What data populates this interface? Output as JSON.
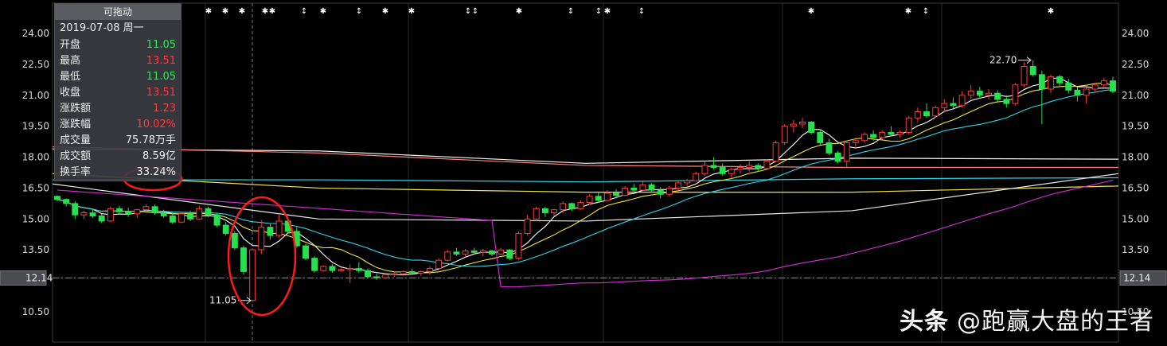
{
  "panel": {
    "title": "可拖动",
    "date": "2019-07-08 周一",
    "rows": [
      {
        "label": "开盘",
        "value": "11.05",
        "color": "green"
      },
      {
        "label": "最高",
        "value": "13.51",
        "color": "red"
      },
      {
        "label": "最低",
        "value": "11.05",
        "color": "green"
      },
      {
        "label": "收盘",
        "value": "13.51",
        "color": "red"
      },
      {
        "label": "涨跌额",
        "value": "1.23",
        "color": "red"
      },
      {
        "label": "涨跌幅",
        "value": "10.02%",
        "color": "red"
      },
      {
        "label": "成交量",
        "value": "75.78万手",
        "color": "white"
      },
      {
        "label": "成交额",
        "value": "8.59亿",
        "color": "white"
      },
      {
        "label": "换手率",
        "value": "33.24%",
        "color": "white"
      }
    ]
  },
  "watermark": {
    "brand": "头条",
    "handle": "@跑赢大盘的王者"
  },
  "chart_data": {
    "type": "candlestick",
    "y_ticks": [
      "24.00",
      "22.50",
      "21.00",
      "19.50",
      "18.00",
      "16.50",
      "15.00",
      "13.50",
      "10.50"
    ],
    "ylim": [
      9.8,
      24.8
    ],
    "crosshair_price": "12.14",
    "annotations": [
      {
        "text": "11.05",
        "value": 11.05
      },
      {
        "text": "22.70",
        "value": 22.7
      }
    ],
    "up_color": "#ff3b3b",
    "down_color": "#27e04d",
    "candles": [
      [
        16.1,
        16.15,
        15.85,
        15.95
      ],
      [
        15.95,
        16.0,
        15.6,
        15.75
      ],
      [
        15.75,
        15.85,
        15.0,
        15.2
      ],
      [
        15.2,
        15.4,
        15.0,
        15.3
      ],
      [
        15.3,
        15.45,
        15.05,
        15.15
      ],
      [
        15.15,
        15.25,
        14.8,
        14.9
      ],
      [
        14.9,
        15.6,
        14.85,
        15.5
      ],
      [
        15.5,
        15.65,
        15.2,
        15.35
      ],
      [
        15.35,
        15.55,
        15.1,
        15.25
      ],
      [
        15.25,
        15.5,
        15.05,
        15.45
      ],
      [
        15.45,
        15.7,
        15.3,
        15.6
      ],
      [
        15.6,
        15.7,
        15.2,
        15.3
      ],
      [
        15.3,
        15.45,
        15.05,
        15.15
      ],
      [
        15.15,
        15.3,
        14.75,
        14.85
      ],
      [
        14.85,
        15.35,
        14.8,
        15.25
      ],
      [
        15.25,
        15.4,
        14.9,
        15.0
      ],
      [
        15.0,
        15.65,
        14.95,
        15.5
      ],
      [
        15.5,
        15.6,
        15.1,
        15.2
      ],
      [
        15.2,
        15.3,
        14.6,
        14.7
      ],
      [
        14.7,
        14.85,
        14.2,
        14.3
      ],
      [
        14.3,
        14.4,
        13.5,
        13.6
      ],
      [
        13.6,
        13.7,
        12.3,
        12.45
      ],
      [
        11.05,
        13.51,
        11.05,
        13.51
      ],
      [
        13.51,
        14.95,
        13.3,
        14.6
      ],
      [
        14.6,
        14.8,
        14.0,
        14.2
      ],
      [
        14.2,
        15.2,
        14.1,
        14.9
      ],
      [
        14.9,
        15.1,
        14.3,
        14.4
      ],
      [
        14.4,
        14.6,
        13.6,
        13.7
      ],
      [
        13.7,
        13.8,
        13.0,
        13.1
      ],
      [
        13.1,
        13.2,
        12.4,
        12.5
      ],
      [
        12.5,
        12.75,
        12.45,
        12.7
      ],
      [
        12.7,
        12.8,
        12.4,
        12.5
      ],
      [
        12.5,
        12.6,
        12.45,
        12.55
      ],
      [
        12.55,
        12.8,
        11.9,
        12.6
      ],
      [
        12.6,
        12.9,
        12.4,
        12.5
      ],
      [
        12.5,
        12.6,
        12.15,
        12.2
      ],
      [
        12.2,
        12.35,
        12.05,
        12.15
      ],
      [
        12.15,
        12.35,
        12.1,
        12.3
      ],
      [
        12.3,
        12.45,
        12.2,
        12.35
      ],
      [
        12.35,
        12.5,
        12.3,
        12.45
      ],
      [
        12.45,
        12.6,
        12.3,
        12.38
      ],
      [
        12.38,
        12.5,
        12.25,
        12.45
      ],
      [
        12.45,
        12.7,
        12.3,
        12.6
      ],
      [
        12.6,
        13.1,
        12.5,
        13.0
      ],
      [
        13.0,
        13.5,
        12.95,
        13.4
      ],
      [
        13.4,
        13.6,
        13.2,
        13.3
      ],
      [
        13.3,
        13.55,
        13.15,
        13.45
      ],
      [
        13.45,
        13.6,
        13.3,
        13.38
      ],
      [
        13.38,
        13.55,
        13.2,
        13.45
      ],
      [
        13.45,
        13.5,
        13.2,
        13.3
      ],
      [
        13.3,
        13.6,
        13.25,
        13.5
      ],
      [
        13.5,
        13.55,
        13.0,
        13.1
      ],
      [
        13.1,
        14.4,
        13.0,
        14.3
      ],
      [
        14.3,
        15.2,
        14.2,
        15.0
      ],
      [
        15.0,
        15.6,
        14.9,
        15.5
      ],
      [
        15.5,
        15.6,
        15.1,
        15.3
      ],
      [
        15.3,
        15.5,
        15.15,
        15.45
      ],
      [
        15.45,
        15.85,
        15.3,
        15.75
      ],
      [
        15.75,
        15.8,
        15.4,
        15.5
      ],
      [
        15.5,
        15.9,
        15.45,
        15.8
      ],
      [
        15.8,
        16.2,
        15.7,
        16.1
      ],
      [
        16.1,
        16.3,
        15.8,
        15.9
      ],
      [
        15.9,
        16.4,
        15.85,
        16.25
      ],
      [
        16.25,
        16.45,
        16.0,
        16.15
      ],
      [
        16.15,
        16.6,
        16.1,
        16.5
      ],
      [
        16.5,
        16.7,
        16.3,
        16.4
      ],
      [
        16.4,
        16.8,
        16.35,
        16.65
      ],
      [
        16.65,
        16.75,
        16.3,
        16.4
      ],
      [
        16.4,
        16.55,
        16.0,
        16.2
      ],
      [
        16.2,
        16.6,
        16.1,
        16.5
      ],
      [
        16.5,
        16.85,
        16.4,
        16.75
      ],
      [
        16.75,
        16.95,
        16.6,
        16.85
      ],
      [
        16.85,
        17.3,
        16.8,
        17.2
      ],
      [
        17.2,
        17.8,
        17.1,
        17.6
      ],
      [
        17.6,
        18.0,
        17.4,
        17.5
      ],
      [
        17.5,
        17.7,
        17.1,
        17.2
      ],
      [
        17.2,
        17.5,
        17.0,
        17.4
      ],
      [
        17.4,
        17.65,
        17.2,
        17.5
      ],
      [
        17.5,
        17.8,
        17.3,
        17.6
      ],
      [
        17.6,
        17.7,
        17.3,
        17.45
      ],
      [
        17.45,
        17.9,
        17.4,
        17.8
      ],
      [
        17.8,
        18.8,
        17.75,
        18.7
      ],
      [
        18.7,
        19.6,
        18.6,
        19.5
      ],
      [
        19.5,
        19.8,
        19.2,
        19.6
      ],
      [
        19.6,
        19.9,
        19.4,
        19.7
      ],
      [
        19.7,
        19.75,
        19.1,
        19.2
      ],
      [
        19.2,
        19.35,
        18.6,
        18.7
      ],
      [
        18.7,
        18.9,
        18.1,
        18.2
      ],
      [
        18.2,
        18.3,
        17.7,
        17.8
      ],
      [
        17.8,
        18.8,
        17.5,
        18.7
      ],
      [
        18.7,
        18.95,
        18.5,
        18.8
      ],
      [
        18.8,
        19.2,
        18.7,
        19.1
      ],
      [
        19.1,
        19.3,
        18.8,
        18.95
      ],
      [
        18.95,
        19.3,
        18.85,
        19.2
      ],
      [
        19.2,
        19.5,
        19.0,
        19.1
      ],
      [
        19.1,
        19.3,
        18.95,
        19.2
      ],
      [
        19.2,
        20.0,
        19.1,
        19.9
      ],
      [
        19.9,
        20.4,
        19.7,
        20.2
      ],
      [
        20.2,
        20.6,
        19.9,
        20.0
      ],
      [
        20.0,
        20.5,
        19.9,
        20.4
      ],
      [
        20.4,
        20.8,
        20.2,
        20.6
      ],
      [
        20.6,
        20.9,
        20.3,
        20.5
      ],
      [
        20.5,
        21.2,
        20.4,
        21.0
      ],
      [
        21.0,
        21.5,
        20.8,
        21.2
      ],
      [
        21.2,
        21.4,
        20.85,
        21.0
      ],
      [
        21.0,
        21.3,
        20.8,
        21.1
      ],
      [
        21.1,
        21.25,
        20.7,
        20.8
      ],
      [
        20.8,
        21.0,
        20.4,
        20.6
      ],
      [
        20.6,
        21.6,
        20.5,
        21.5
      ],
      [
        21.5,
        22.6,
        21.4,
        22.4
      ],
      [
        22.4,
        22.7,
        21.9,
        22.0
      ],
      [
        22.0,
        22.2,
        19.6,
        21.3
      ],
      [
        21.3,
        22.0,
        21.1,
        21.9
      ],
      [
        21.9,
        22.0,
        21.4,
        21.6
      ],
      [
        21.6,
        21.8,
        21.1,
        21.25
      ],
      [
        21.25,
        21.4,
        20.7,
        21.0
      ],
      [
        21.0,
        21.4,
        20.6,
        21.3
      ],
      [
        21.3,
        21.6,
        21.1,
        21.5
      ],
      [
        21.5,
        21.85,
        21.3,
        21.7
      ],
      [
        21.7,
        21.9,
        21.1,
        21.2
      ]
    ],
    "moving_averages": [
      {
        "color": "#ffffff",
        "window": 5
      },
      {
        "color": "#f2e63c",
        "window": 10
      },
      {
        "color": "#2fd2e8",
        "window": 20
      },
      {
        "color": "#d62fd6",
        "window": 60
      }
    ],
    "long_lines": [
      {
        "color": "#f2f2f2",
        "values": [
          18.4,
          18.3,
          17.7,
          17.95,
          17.9
        ]
      },
      {
        "color": "#ff8080",
        "values": [
          18.5,
          18.2,
          17.6,
          17.5,
          17.5
        ]
      },
      {
        "color": "#2fd2e8",
        "values": [
          16.9,
          16.9,
          16.8,
          16.95,
          17.0
        ]
      },
      {
        "color": "#f2e63c",
        "values": [
          17.2,
          16.5,
          16.3,
          16.3,
          16.6
        ]
      },
      {
        "color": "#e8e8e8",
        "values": [
          16.7,
          15.0,
          14.9,
          15.4,
          17.2
        ]
      }
    ]
  }
}
